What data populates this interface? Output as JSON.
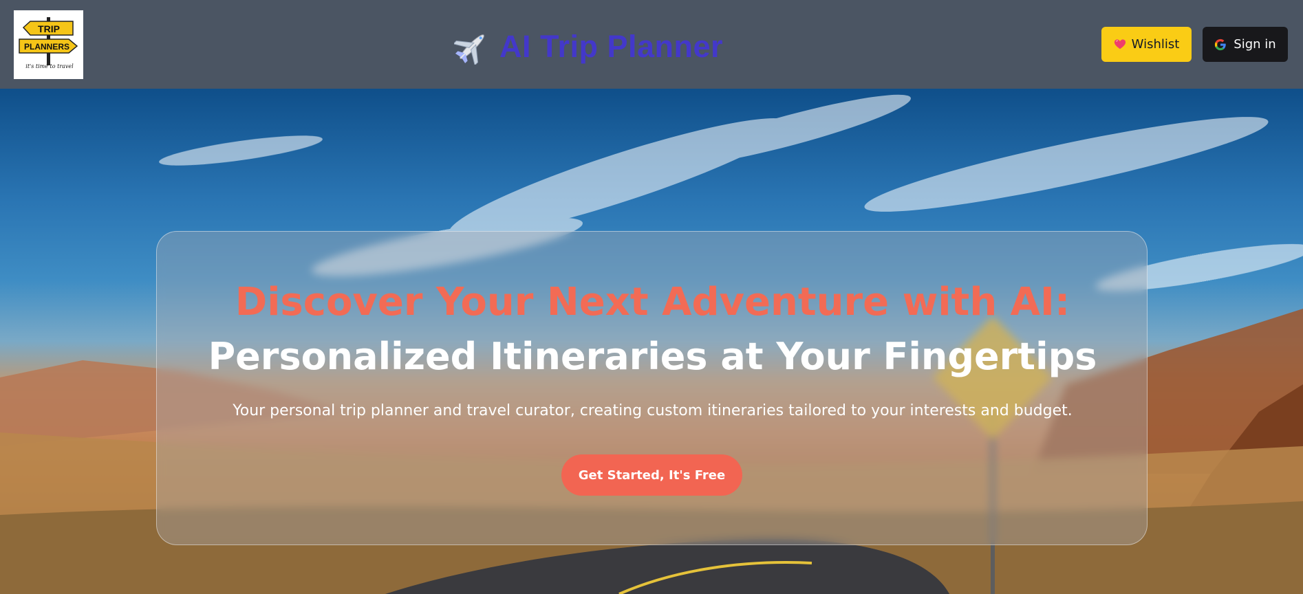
{
  "header": {
    "logo": {
      "line1": "TRIP",
      "line2": "PLANNERS",
      "tagline": "it's time to travel"
    },
    "brand_icon": "airplane-icon",
    "brand_title": "AI Trip Planner",
    "wishlist_label": "Wishlist",
    "wishlist_icon": "heart-icon",
    "signin_label": "Sign in",
    "signin_icon": "google-icon"
  },
  "hero": {
    "headline_line1": "Discover Your Next Adventure with AI:",
    "headline_line2": "Personalized Itineraries at Your Fingertips",
    "subtitle": "Your personal trip planner and travel curator, creating custom itineraries tailored to your interests and budget.",
    "cta_label": "Get Started, It's Free"
  },
  "colors": {
    "header_bg": "#4b5563",
    "brand_title": "#4338ca",
    "wishlist_bg": "#facc15",
    "signin_bg": "#18181b",
    "headline_accent": "#f26b55",
    "cta_bg": "#f26552"
  }
}
